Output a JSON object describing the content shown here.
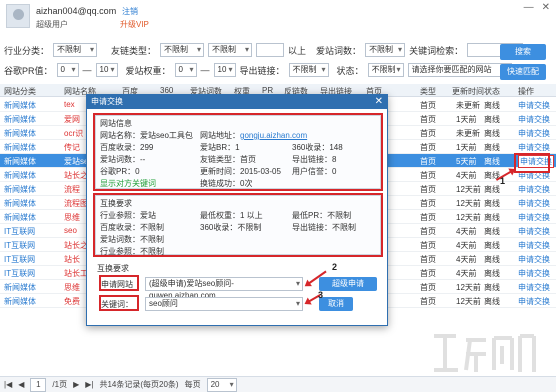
{
  "header": {
    "username": "aizhan004@qq.com",
    "user_type": "超级用户",
    "register": "注销",
    "upgrade": "升级VIP"
  },
  "filters": {
    "row1": {
      "industry_label": "行业分类：",
      "industry_value": "不限制",
      "friendlink_label": "友链类型：",
      "friendlink_value": "不限制",
      "baidu_label": "百度收录",
      "baidu_value": "不限制",
      "above": "以上",
      "weight_label": "爱站词数：",
      "weight_value": "不限制",
      "keyword_label": "关键词检索：",
      "search_btn": "搜索"
    },
    "row2": {
      "pr_label": "谷歌PR值：",
      "pr_min": "0",
      "pr_max": "10",
      "br_label": "爱站权重：",
      "br_min": "0",
      "br_max": "10",
      "export_label": "导出链接：",
      "export_value": "不限制",
      "status_label": "状态：",
      "status_value": "不限制",
      "match_value": "请选择你要匹配的网站",
      "quick_btn": "快速匹配"
    }
  },
  "table": {
    "headers": [
      "网站分类",
      "网站名称",
      "百度",
      "360",
      "爱站词数",
      "权重",
      "PR",
      "反链数",
      "导出链接",
      "首页",
      "类型",
      "更新时间",
      "状态",
      "操作"
    ],
    "rows": [
      {
        "cat": "新闻媒体",
        "name": "tex",
        "type": "首页",
        "time": "未更新",
        "status": "离线",
        "action": "申请交换"
      },
      {
        "cat": "新闻媒体",
        "name": "爱网",
        "type": "首页",
        "time": "1天前",
        "status": "离线",
        "action": "申请交换"
      },
      {
        "cat": "新闻媒体",
        "name": "ocr识",
        "type": "首页",
        "time": "未更新",
        "status": "离线",
        "action": "申请交换"
      },
      {
        "cat": "新闻媒体",
        "name": "传记",
        "type": "首页",
        "time": "1天前",
        "status": "离线",
        "action": "申请交换"
      },
      {
        "cat": "新闻媒体",
        "name": "爱站seo",
        "type": "首页",
        "time": "5天前",
        "status": "离线",
        "action": "申请交换"
      },
      {
        "cat": "新闻媒体",
        "name": "站长之",
        "type": "首页",
        "time": "4天前",
        "status": "离线",
        "action": "申请交换"
      },
      {
        "cat": "新闻媒体",
        "name": "流程",
        "type": "首页",
        "time": "12天前",
        "status": "离线",
        "action": "申请交换"
      },
      {
        "cat": "新闻媒体",
        "name": "流程图",
        "type": "首页",
        "time": "12天前",
        "status": "离线",
        "action": "申请交换"
      },
      {
        "cat": "新闻媒体",
        "name": "思维",
        "type": "首页",
        "time": "12天前",
        "status": "离线",
        "action": "申请交换"
      },
      {
        "cat": "IT互联网",
        "name": "seo",
        "type": "首页",
        "time": "4天前",
        "status": "离线",
        "action": "申请交换"
      },
      {
        "cat": "IT互联网",
        "name": "站长之",
        "type": "首页",
        "time": "4天前",
        "status": "离线",
        "action": "申请交换"
      },
      {
        "cat": "IT互联网",
        "name": "站长",
        "type": "首页",
        "time": "4天前",
        "status": "离线",
        "action": "申请交换"
      },
      {
        "cat": "IT互联网",
        "name": "站长工",
        "type": "首页",
        "time": "4天前",
        "status": "离线",
        "action": "申请交换"
      },
      {
        "cat": "新闻媒体",
        "name": "思维",
        "type": "首页",
        "time": "12天前",
        "status": "离线",
        "action": "申请交换"
      },
      {
        "cat": "新闻媒体",
        "name": "免费",
        "type": "首页",
        "time": "12天前",
        "status": "离线",
        "action": "申请交换"
      }
    ]
  },
  "pager": {
    "page": "1",
    "of": "/1页",
    "summary": "共14条记录(每页20条)",
    "per_page_label": "每页",
    "per_page": "20"
  },
  "dialog": {
    "title": "申请交换",
    "close": "✕",
    "site_info": {
      "header": "网站信息",
      "name": "网站名称：爱站seo工具包",
      "url_label": "网站地址：",
      "url": "gongju.aizhan.com",
      "baidu": "百度收录：299",
      "br": "爱站BR：1",
      "s360": "360收录：148",
      "words": "爱站词数：--",
      "friend_type": "友链类型：首页",
      "export": "导出链接：8",
      "pr": "谷歌PR：0",
      "update": "更新时间：2015-03-05",
      "credit": "用户信誉：0",
      "keyword_link": "显示对方关键词",
      "success": "换链成功：0次"
    },
    "exchange_req": {
      "header": "互换要求",
      "industry": "行业参照：爱站",
      "min_weight": "最低权重：1 以上",
      "min_pr": "最低PR：不限制",
      "baidu": "百度收录：不限制",
      "s360": "360收录：不限制",
      "export": "导出链接：不限制",
      "words": "爱站词数：不限制",
      "industry2": "行业参照：不限制"
    },
    "apply": {
      "header": "互换要求",
      "site_label": "申请网站",
      "site_value": "(超级申请)爱站seo顾问-guwen.aizhan.com",
      "add_btn": "超级申请",
      "kw_label": "关键词：",
      "kw_value": "seo顾问",
      "cancel_btn": "取消"
    },
    "markers": [
      "1",
      "2",
      "3"
    ]
  }
}
